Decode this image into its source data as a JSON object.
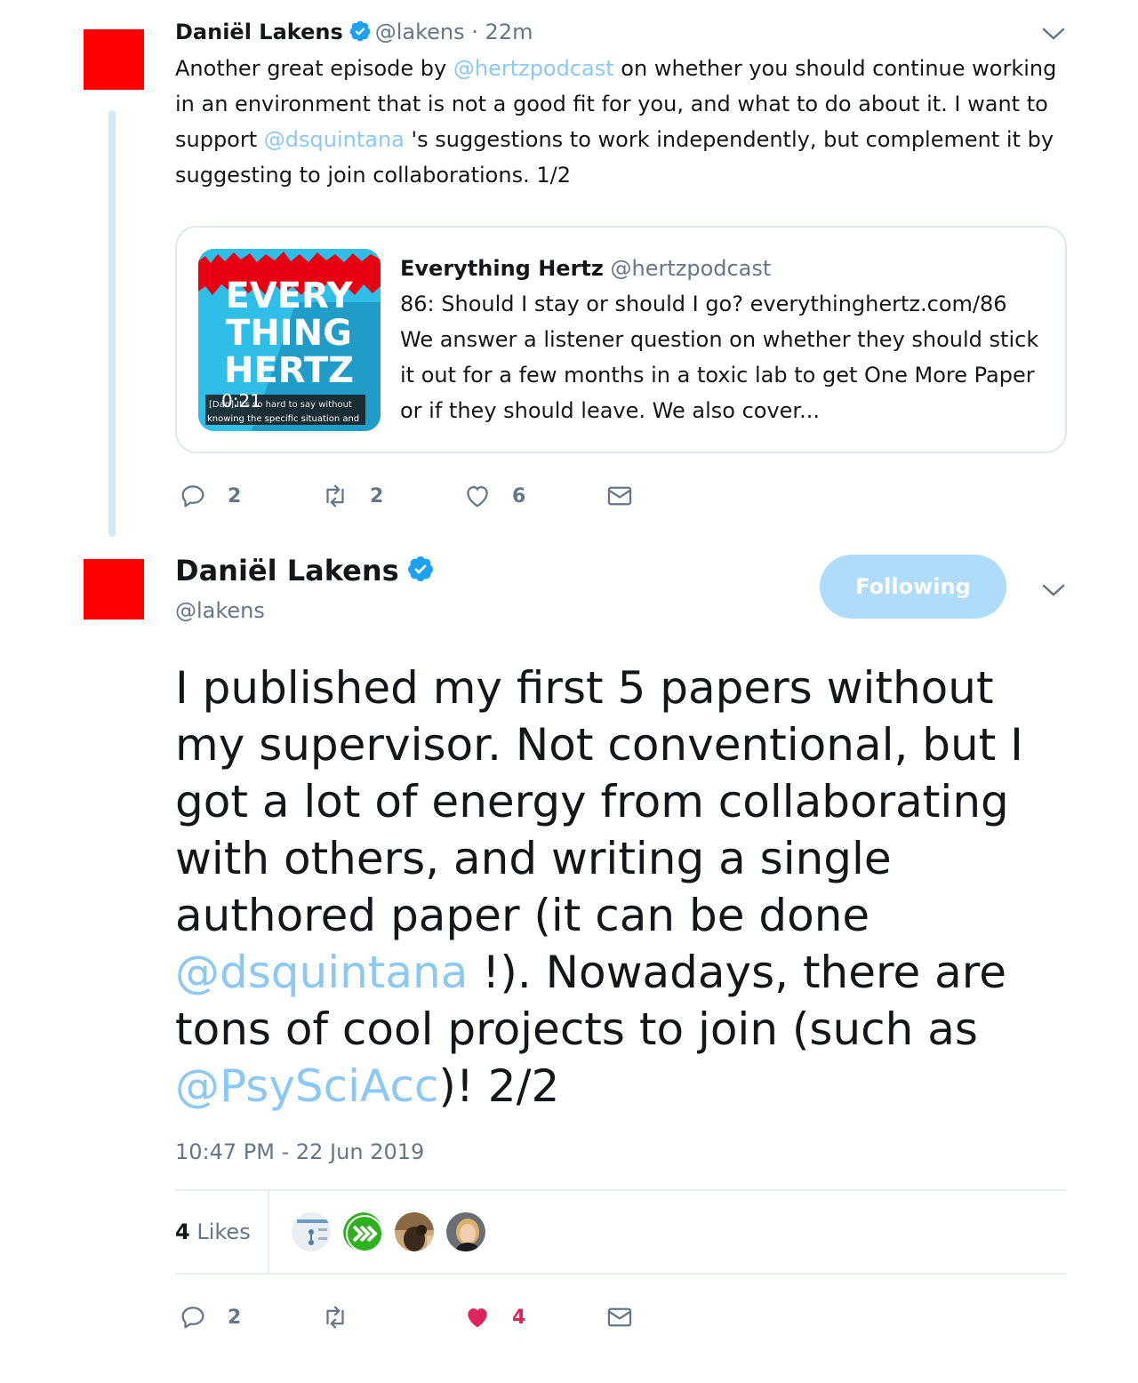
{
  "tweet1": {
    "name": "Daniël Lakens",
    "handle": "@lakens",
    "time": "· 22m",
    "text_parts": {
      "p1": "Another great episode by ",
      "m1": "@hertzpodcast",
      "p2": " on whether you should continue working in an environment that is not a good fit for you, and what to do about it. I want to support ",
      "m2": "@dsquintana",
      "p3": " 's suggestions to work independently, but complement it by suggesting to join collaborations. 1/2"
    },
    "card": {
      "title": "Everything Hertz",
      "handle": "@hertzpodcast",
      "description": "86: Should I stay or should I go? everythinghertz.com/86 We answer a listener question on whether they should stick it out for a few months in a toxic lab to get One More Paper or if they should leave. We also cover...",
      "thumb": {
        "word1": "EVERY",
        "word2": "THING",
        "word3": "HERTZ",
        "duration": "0:21",
        "caption1": "[Dan] It's so hard to say without",
        "caption2": "knowing the specific situation and"
      }
    },
    "actions": {
      "replies": "2",
      "retweets": "2",
      "likes": "6"
    }
  },
  "tweet2": {
    "name": "Daniël Lakens",
    "handle": "@lakens",
    "follow_label": "Following",
    "text_parts": {
      "p1": "I published my first 5 papers without my supervisor. Not conventional, but I got a lot of energy from collaborating with others, and writing a single authored paper (it can be done ",
      "m1": "@dsquintana",
      "p2": " !). Nowadays, there are tons of cool projects to join (such as ",
      "m2": "@PsySciAcc",
      "p3": ")! 2/2"
    },
    "timestamp": "10:47 PM - 22 Jun 2019",
    "likes_count": "4",
    "likes_label": "Likes",
    "actions": {
      "replies": "2",
      "retweets": "",
      "likes": "4"
    }
  },
  "colors": {
    "link": "#8cc8f4",
    "verified": "#1da1f2",
    "liked": "#e0245e",
    "follow_button": "#aedcfa",
    "avatar": "#ff0000"
  },
  "icons": [
    "verified-badge-icon",
    "chevron-down-icon",
    "reply-icon",
    "retweet-icon",
    "heart-icon",
    "heart-filled-icon",
    "mail-icon"
  ]
}
